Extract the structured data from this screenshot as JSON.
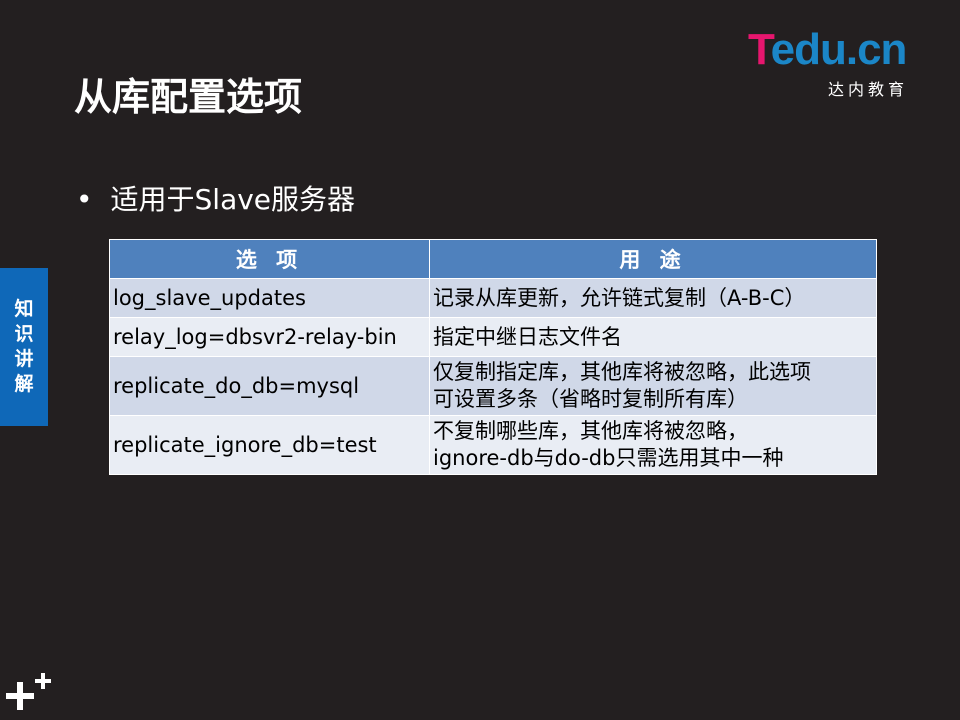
{
  "logo": {
    "text_t": "T",
    "text_rest": "edu.cn",
    "subtitle": "达内教育"
  },
  "slide": {
    "title": "从库配置选项",
    "bullet": "适用于Slave服务器",
    "side_tab": "知识讲解"
  },
  "table": {
    "headers": [
      "选 项",
      "用 途"
    ],
    "rows": [
      {
        "option": "log_slave_updates",
        "purpose": [
          "记录从库更新，允许链式复制（A-B-C）"
        ]
      },
      {
        "option": "relay_log=dbsvr2-relay-bin",
        "purpose": [
          "指定中继日志文件名"
        ]
      },
      {
        "option": "replicate_do_db=mysql",
        "purpose": [
          "仅复制指定库，其他库将被忽略，此选项",
          "可设置多条（省略时复制所有库）"
        ]
      },
      {
        "option": "replicate_ignore_db=test",
        "purpose": [
          "不复制哪些库，其他库将被忽略，",
          "ignore-db与do-db只需选用其中一种"
        ]
      }
    ]
  },
  "colors": {
    "background": "#231f20",
    "header": "#4f81bd",
    "row_odd": "#d0d8e8",
    "row_even": "#e9edf4",
    "side_tab": "#0f68b8",
    "logo_blue": "#1b86c7",
    "logo_pink": "#e6166e"
  },
  "icons": {
    "logo": "tedu-logo",
    "decoration": "plus-cluster-icon"
  }
}
